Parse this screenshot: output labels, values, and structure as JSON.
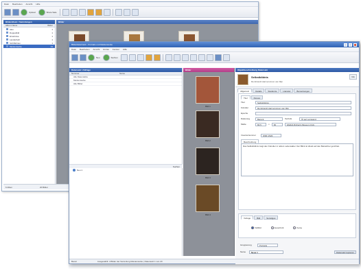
{
  "back_window": {
    "menu": [
      "Datei",
      "Bearbeiten",
      "Ansicht",
      "Hilfe"
    ],
    "toolbar": {
      "btn_upload": "Upload",
      "btn_share": "Share Sale"
    },
    "left_panel": {
      "title": "Bilderalbum / Sammlungen",
      "col_name": "Album Name",
      "col_count": "Bilder",
      "items": [
        {
          "label": "Alex",
          "count": "1"
        },
        {
          "label": "Doppelbild",
          "count": "1"
        },
        {
          "label": "Ernebnise",
          "count": "1"
        },
        {
          "label": "Landschaft",
          "count": "1"
        },
        {
          "label": "Schiffahrten",
          "count": "1"
        },
        {
          "label": "Meisterwerke",
          "count": "13"
        }
      ]
    },
    "grid_header": "Bilder",
    "status": {
      "albums": "6 Alben",
      "images": "20 Bilder"
    }
  },
  "front_window": {
    "title": "Bilderdatenbank - Portraits und Meisterwerke",
    "menu": [
      "Datei",
      "Bearbeiten",
      "Ansicht",
      "Extras",
      "Fenster",
      "Hilfe"
    ],
    "toolbar": {
      "btn_neu": "Neu",
      "btn_suchen": "Suchen",
      "btn_export": "Export"
    },
    "left_panel": {
      "title": "Datensatz / Abfrage",
      "col_a": "Nummer",
      "col_b": "Name",
      "fields": [
        "Alle Datensätze",
        "Meisterwerke",
        "Alle Bilder"
      ],
      "bottom_btn": "Suchen",
      "tree_item": "Neu 1"
    },
    "mid_panel": {
      "title": "Bilder",
      "captions": [
        "Bild 1",
        "Bild 2",
        "Bild 3",
        "Bild 4"
      ]
    },
    "right_panel": {
      "header": "Objektbeschreibung Datensatz",
      "record_title": "Selbstbildnis",
      "record_sub": "Rembrandt Harmenszoon van Rijn",
      "info_btn": "Info",
      "tabs": [
        "Allgemein",
        "Details",
        "Standorte",
        "Literatur",
        "Bemerkungen"
      ],
      "inner_tabs": [
        "Titel",
        "Person"
      ],
      "fields": {
        "titel_label": "Titel",
        "titel_value": "Selbstbildnis",
        "kuenstler_label": "Künstler",
        "kuenstler_value": "Rembrandt Harmenszoon van Rijn",
        "epoche_label": "Epoche",
        "datum_label": "Datierung",
        "datum_value": "Barock",
        "technik_label": "Technik",
        "technik_value": "Öl auf Leinwand",
        "masse_label": "Maße",
        "masse_w": "84,5",
        "masse_h": "66",
        "ort_value": "Wallraf-Richartz-Museum Köln",
        "inventar_label": "Inventarnummer",
        "inventar_value": "WRF 2526",
        "beschreibung_label": "Beschreibung",
        "beschreibung_text": "Das Selbstbildnis zeigt den Künstler in reifem Lebensalter. Der Blick ist direkt auf den Betrachter gerichtet."
      },
      "lower_tabs": [
        "Vorlage",
        "Bild",
        "Sonstiges"
      ],
      "radios": [
        {
          "label": "Vollbild",
          "on": true
        },
        {
          "label": "Ausschnitt",
          "on": false
        },
        {
          "label": "Keine",
          "on": false
        }
      ],
      "foot_label": "Gruppierung",
      "foot_value": "Portraits",
      "name_label": "Name",
      "name_value": "Neue 1",
      "foot_btn": "Datensatz kopieren"
    },
    "status": {
      "ready": "Bereit",
      "info": "Ausgewählt: 4 Bilder der Sammlung Meisterwerke | Datensatz 1 von 20"
    }
  }
}
